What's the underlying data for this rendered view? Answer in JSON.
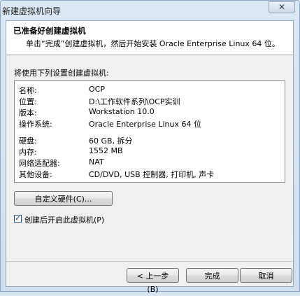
{
  "window": {
    "title": "新建虚拟机向导",
    "close_glyph": "✕"
  },
  "header": {
    "title": "已准备好创建虚拟机",
    "subtitle": "单击“完成”创建虚拟机，然后开始安装 Oracle Enterprise Linux 64 位。"
  },
  "intro": "将使用下列设置创建虚拟机:",
  "summary": {
    "rows": [
      {
        "key": "名称:",
        "value": "OCP"
      },
      {
        "key": "位置:",
        "value": "D:\\工作软件系列\\OCP实训"
      },
      {
        "key": "版本:",
        "value": "Workstation 10.0"
      },
      {
        "key": "操作系统:",
        "value": "Oracle Enterprise Linux 64 位"
      },
      {
        "key": "硬盘:",
        "value": "60 GB, 拆分"
      },
      {
        "key": "内存:",
        "value": "1552 MB"
      },
      {
        "key": "网络适配器:",
        "value": "NAT"
      },
      {
        "key": "其他设备:",
        "value": "CD/DVD, USB 控制器, 打印机, 声卡"
      }
    ]
  },
  "buttons": {
    "customize": "自定义硬件(C)...",
    "back": "< 上一步(B)",
    "finish": "完成",
    "cancel": "取消"
  },
  "power_on": {
    "label": "创建后开启此虚拟机(P)",
    "checked": true,
    "check_glyph": "✓"
  }
}
